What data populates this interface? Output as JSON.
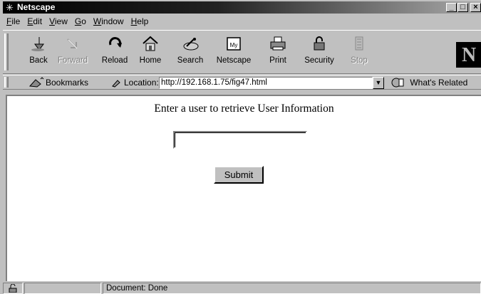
{
  "window": {
    "title": "Netscape"
  },
  "menu": [
    {
      "key": "F",
      "rest": "ile"
    },
    {
      "key": "E",
      "rest": "dit"
    },
    {
      "key": "V",
      "rest": "iew"
    },
    {
      "key": "G",
      "rest": "o"
    },
    {
      "key": "W",
      "rest": "indow"
    },
    {
      "key": "H",
      "rest": "elp"
    }
  ],
  "toolbar": {
    "back": "Back",
    "forward": "Forward",
    "reload": "Reload",
    "home": "Home",
    "search": "Search",
    "netscape": "Netscape",
    "print": "Print",
    "security": "Security",
    "stop": "Stop",
    "logo": "N"
  },
  "location_bar": {
    "bookmarks": "Bookmarks",
    "location_label": "Location:",
    "url": "http://192.168.1.75/fig47.html",
    "related": "What's Related"
  },
  "page": {
    "prompt": "Enter a user to retrieve User Information",
    "input_value": "",
    "submit": "Submit"
  },
  "status": {
    "text": "Document: Done"
  }
}
